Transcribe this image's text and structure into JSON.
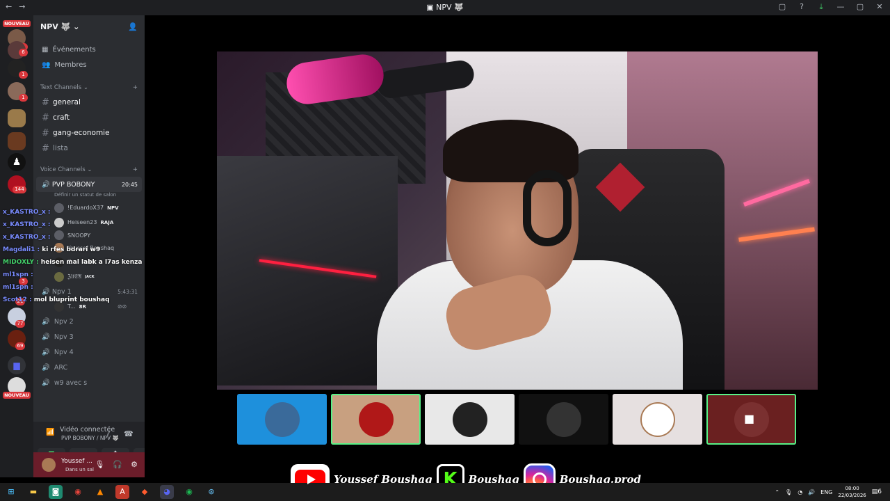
{
  "window": {
    "title": "NPV",
    "back": "←",
    "forward": "→"
  },
  "rail": {
    "nouveau_top": "NOUVEAU",
    "nouveau_bottom": "NOUVEAU",
    "badges": [
      "1",
      "6",
      "1",
      "1",
      "144",
      "3",
      "21",
      "77",
      "69"
    ]
  },
  "sidebar": {
    "server_name": "NPV",
    "nav": [
      {
        "label": "Événements",
        "icon": "calendar-icon"
      },
      {
        "label": "Membres",
        "icon": "members-icon"
      }
    ],
    "text_category": "Text Channels",
    "text_channels": [
      "general",
      "craft",
      "gang-economie",
      "lista"
    ],
    "voice_category": "Voice Channels",
    "voice_active": {
      "name": "PVP BOBONY",
      "time": "20:45",
      "status": "Définir un statut de salon"
    },
    "voice_users": [
      {
        "name": "!EduardoX37",
        "tag": "NPV"
      },
      {
        "name": "Heiseen23",
        "tag": "RAJA"
      },
      {
        "name": "SNOOPY",
        "tag": ""
      },
      {
        "name": "Youssef Boushaq",
        "tag": ""
      },
      {
        "name": "Z...",
        "tag": ""
      },
      {
        "name": "ℨ𝔘𝔈𝔄",
        "tag": "JACK"
      }
    ],
    "npv1": {
      "name": "Npv 1",
      "time": "5:43:31"
    },
    "npv1_user": {
      "name": "T...",
      "tag": "8R"
    },
    "voice_channels": [
      "Npv 2",
      "Npv 3",
      "Npv 4",
      "ARC",
      "w9 avec s"
    ]
  },
  "voice_panel": {
    "status": "Vidéo connectée",
    "sub": "PVP BOBONY / NPV"
  },
  "user": {
    "name": "Youssef ...",
    "status": "Dans un sal"
  },
  "overlay_chat": [
    {
      "user": "x_KASTRO_x :",
      "msg": "",
      "green": false
    },
    {
      "user": "x_KASTRO_x :",
      "msg": "",
      "green": false
    },
    {
      "user": "x_KASTRO_x :",
      "msg": "",
      "green": false
    },
    {
      "user": "Magdali1 :",
      "msg": "ki rfes bdrari w9",
      "green": false
    },
    {
      "user": "MIDOXLY :",
      "msg": "heisen mal labk a l7as kenza",
      "green": true
    },
    {
      "user": "ml1spn :",
      "msg": "",
      "green": false
    },
    {
      "user": "ml1spn :",
      "msg": "",
      "green": false
    },
    {
      "user": "Scot12 :",
      "msg": "mol bluprint boushaq",
      "green": false
    }
  ],
  "branding": {
    "youtube": "Youssef Boushaq",
    "kick": "Boushaq",
    "kick_letter": "K",
    "instagram": "Boushaq.prod"
  },
  "taskbar": {
    "lang": "ENG",
    "time": "08:00",
    "date": "22/03/2026",
    "notif_count": "6"
  }
}
